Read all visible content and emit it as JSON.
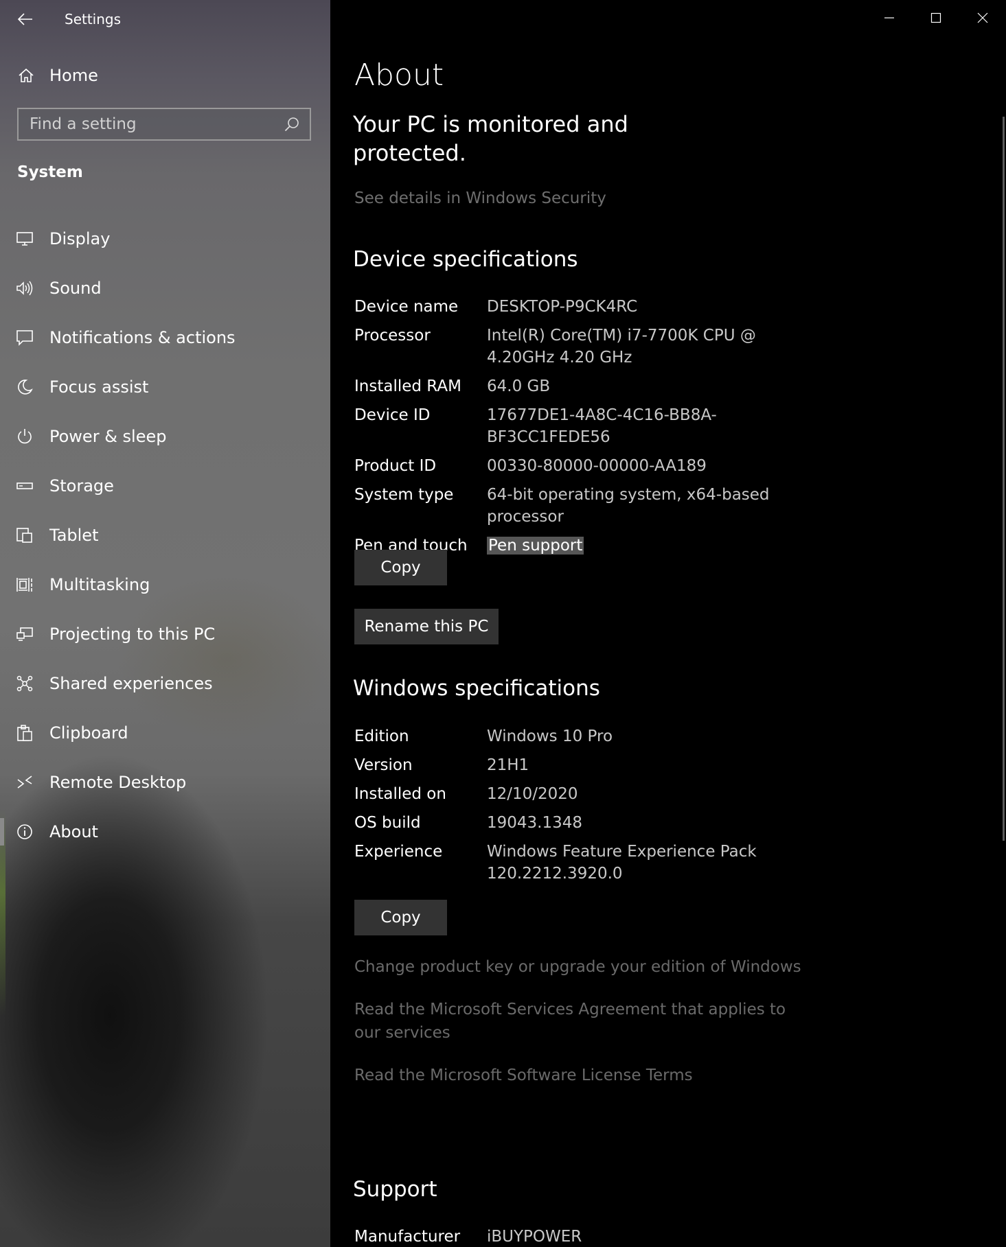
{
  "window": {
    "title": "Settings"
  },
  "sidebar": {
    "home_label": "Home",
    "search_placeholder": "Find a setting",
    "section_label": "System",
    "items": [
      {
        "label": "Display",
        "icon": "monitor-icon"
      },
      {
        "label": "Sound",
        "icon": "speaker-icon"
      },
      {
        "label": "Notifications & actions",
        "icon": "notification-icon"
      },
      {
        "label": "Focus assist",
        "icon": "moon-icon"
      },
      {
        "label": "Power & sleep",
        "icon": "power-icon"
      },
      {
        "label": "Storage",
        "icon": "storage-drive-icon"
      },
      {
        "label": "Tablet",
        "icon": "tablet-icon"
      },
      {
        "label": "Multitasking",
        "icon": "multitasking-icon"
      },
      {
        "label": "Projecting to this PC",
        "icon": "projecting-icon"
      },
      {
        "label": "Shared experiences",
        "icon": "shared-experiences-icon"
      },
      {
        "label": "Clipboard",
        "icon": "clipboard-icon"
      },
      {
        "label": "Remote Desktop",
        "icon": "remote-desktop-icon"
      },
      {
        "label": "About",
        "icon": "info-icon",
        "selected": true
      }
    ]
  },
  "main": {
    "title": "About",
    "protection_text": "Your PC is monitored and protected.",
    "security_link": "See details in Windows Security",
    "device_specs": {
      "heading": "Device specifications",
      "rows": [
        {
          "label": "Device name",
          "value": "DESKTOP-P9CK4RC"
        },
        {
          "label": "Processor",
          "value": "Intel(R) Core(TM) i7-7700K CPU @ 4.20GHz   4.20 GHz"
        },
        {
          "label": "Installed RAM",
          "value": "64.0 GB"
        },
        {
          "label": "Device ID",
          "value": "17677DE1-4A8C-4C16-BB8A-BF3CC1FEDE56"
        },
        {
          "label": "Product ID",
          "value": "00330-80000-00000-AA189"
        },
        {
          "label": "System type",
          "value": "64-bit operating system, x64-based processor"
        },
        {
          "label": "Pen and touch",
          "value": "Pen support"
        }
      ],
      "copy_button": "Copy",
      "rename_button": "Rename this PC"
    },
    "windows_specs": {
      "heading": "Windows specifications",
      "rows": [
        {
          "label": "Edition",
          "value": "Windows 10 Pro"
        },
        {
          "label": "Version",
          "value": "21H1"
        },
        {
          "label": "Installed on",
          "value": "12/10/2020"
        },
        {
          "label": "OS build",
          "value": "19043.1348"
        },
        {
          "label": "Experience",
          "value": "Windows Feature Experience Pack 120.2212.3920.0"
        }
      ],
      "copy_button": "Copy"
    },
    "links": {
      "change_key": "Change product key or upgrade your edition of Windows",
      "services_agreement": "Read the Microsoft Services Agreement that applies to our services",
      "license_terms": "Read the Microsoft Software License Terms"
    },
    "support": {
      "heading": "Support",
      "rows": [
        {
          "label": "Manufacturer",
          "value": "iBUYPOWER"
        }
      ]
    }
  }
}
